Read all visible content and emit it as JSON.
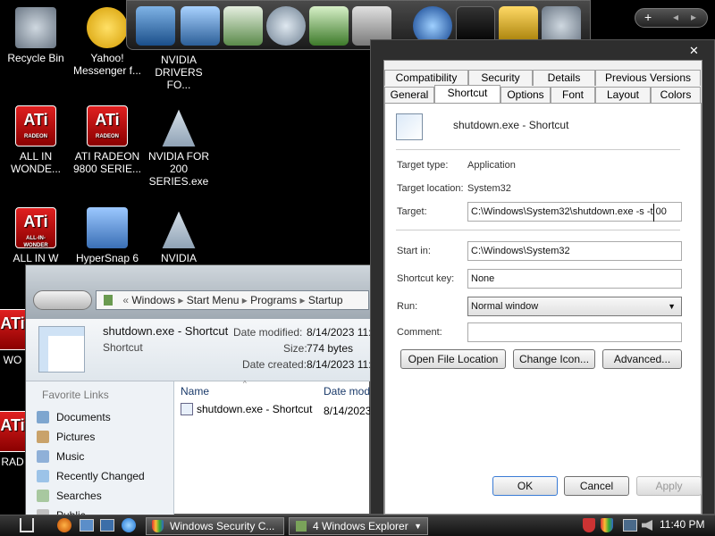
{
  "desktop": {
    "icons": [
      {
        "label": "Recycle Bin",
        "icon": "recycle-bin-icon"
      },
      {
        "label": "Yahoo! Messenger f...",
        "icon": "yahoo-messenger-icon"
      },
      {
        "label": "NVIDIA DRIVERS FO...",
        "icon": "nvidia-icon"
      },
      {
        "label": "ALL IN WONDE...",
        "icon": "ati-radeon-icon"
      },
      {
        "label": "ATI RADEON 9800 SERIE...",
        "icon": "ati-radeon-icon"
      },
      {
        "label": "NVIDIA FOR 200 SERIES.exe",
        "icon": "nvidia-icon"
      },
      {
        "label": "ALL IN W",
        "icon": "ati-all-in-wonder-icon"
      },
      {
        "label": "HyperSnap 6",
        "icon": "hypersnap-icon"
      },
      {
        "label": "NVIDIA",
        "icon": "nvidia-icon"
      },
      {
        "label": "WO",
        "icon": "ati-radeon-icon"
      },
      {
        "label": "RAD",
        "icon": "ati-radeon-icon"
      }
    ]
  },
  "dock": {
    "top_controls": [
      "+",
      "◂",
      "▸"
    ]
  },
  "properties": {
    "close": "✕",
    "tabs_row1": [
      "Compatibility",
      "Security",
      "Details",
      "Previous Versions"
    ],
    "tabs_row2": [
      "General",
      "Shortcut",
      "Options",
      "Font",
      "Layout",
      "Colors"
    ],
    "selected_tab": "Shortcut",
    "title": "shutdown.exe - Shortcut",
    "target_type_label": "Target type:",
    "target_type": "Application",
    "target_location_label": "Target location:",
    "target_location": "System32",
    "target_label": "Target:",
    "target_value": "C:\\Windows\\System32\\shutdown.exe -s -t 00",
    "start_in_label": "Start in:",
    "start_in_value": "C:\\Windows\\System32",
    "shortcut_key_label": "Shortcut key:",
    "shortcut_key_value": "None",
    "run_label": "Run:",
    "run_value": "Normal window",
    "comment_label": "Comment:",
    "comment_value": "",
    "open_file_location": "Open File Location",
    "change_icon": "Change Icon...",
    "advanced": "Advanced...",
    "ok": "OK",
    "cancel": "Cancel",
    "apply": "Apply"
  },
  "explorer": {
    "breadcrumb": [
      "Windows",
      "Start Menu",
      "Programs",
      "Startup"
    ],
    "item_name": "shutdown.exe - Shortcut",
    "item_type": "Shortcut",
    "date_modified_label": "Date modified:",
    "date_modified": "8/14/2023 11:",
    "size_label": "Size:",
    "size": "774 bytes",
    "date_created_label": "Date created:",
    "date_created": "8/14/2023 11:",
    "favorite_links_label": "Favorite Links",
    "favorites": [
      "Documents",
      "Pictures",
      "Music",
      "Recently Changed",
      "Searches",
      "Public"
    ],
    "col_name": "Name",
    "col_date": "Date mod",
    "row_name": "shutdown.exe - Shortcut",
    "row_date": "8/14/2023"
  },
  "taskbar": {
    "btn1": "Windows Security C...",
    "btn2": "4  Windows Explorer",
    "clock": "11:40 PM"
  },
  "colors": {
    "desktop_bg": "#000000",
    "ati_red": "#c01010",
    "dialog_frame": "#2e2e2e"
  }
}
